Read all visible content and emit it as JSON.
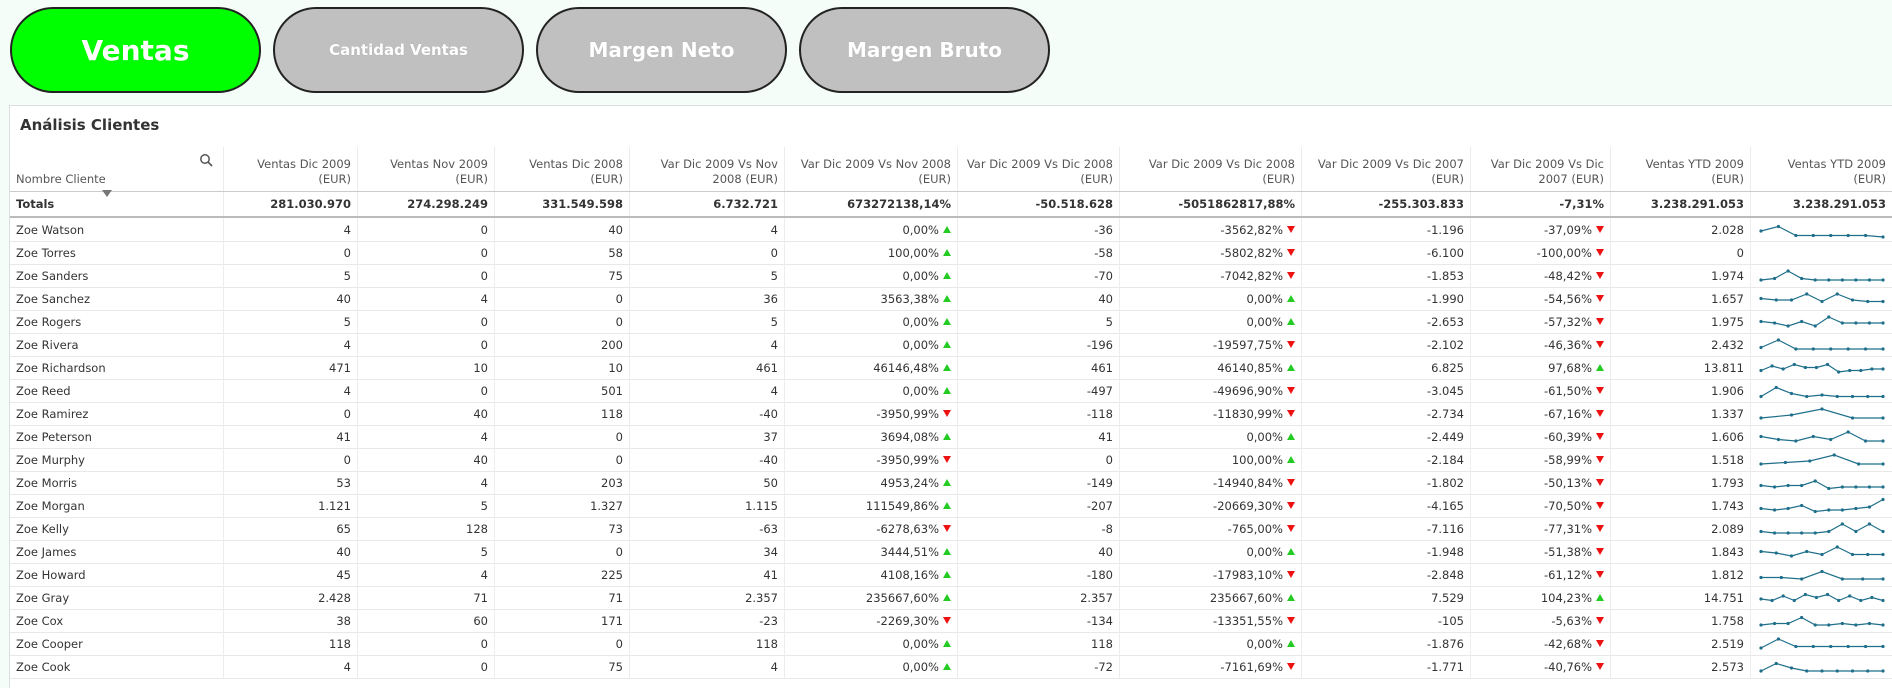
{
  "tabs": [
    {
      "label": "Ventas",
      "active": true
    },
    {
      "label": "Cantidad Ventas",
      "active": false
    },
    {
      "label": "Margen Neto",
      "active": false
    },
    {
      "label": "Margen Bruto",
      "active": false
    }
  ],
  "panel": {
    "title": "Análisis Clientes"
  },
  "table": {
    "headers": [
      "Nombre Cliente",
      "Ventas Dic 2009 (EUR)",
      "Ventas Nov 2009 (EUR)",
      "Ventas Dic 2008 (EUR)",
      "Var Dic 2009 Vs Nov 2008 (EUR)",
      "Var Dic 2009 Vs Nov 2008 (EUR)",
      "Var Dic 2009 Vs Dic 2008 (EUR)",
      "Var Dic 2009 Vs Dic 2008 (EUR)",
      "Var Dic 2009 Vs Dic 2007 (EUR)",
      "Var Dic 2009 Vs Dic 2007 (EUR)",
      "Ventas YTD 2009 (EUR)",
      "Ventas YTD 2009 (EUR)"
    ],
    "totals": [
      "Totals",
      "281.030.970",
      "274.298.249",
      "331.549.598",
      "6.732.721",
      "673272138,14%",
      "-50.518.628",
      "-5051862817,88%",
      "-255.303.833",
      "-7,31%",
      "3.238.291.053",
      "3.238.291.053"
    ],
    "rows": [
      {
        "name": "Zoe Watson",
        "c": [
          "4",
          "0",
          "40",
          "4",
          "0,00%",
          "-36",
          "-3562,82%",
          "-1.196",
          "-37,09%",
          "2.028"
        ],
        "a": [
          "up",
          "down",
          "down"
        ],
        "spark": [
          0.6,
          0.3,
          0.9,
          0.9,
          0.9,
          0.9,
          0.9,
          1.0
        ]
      },
      {
        "name": "Zoe Torres",
        "c": [
          "0",
          "0",
          "58",
          "0",
          "100,00%",
          "-58",
          "-5802,82%",
          "-6.100",
          "-100,00%",
          "0"
        ],
        "a": [
          "up",
          "down",
          "down"
        ],
        "spark": []
      },
      {
        "name": "Zoe Sanders",
        "c": [
          "5",
          "0",
          "75",
          "5",
          "0,00%",
          "-70",
          "-7042,82%",
          "-1.853",
          "-48,42%",
          "1.974"
        ],
        "a": [
          "up",
          "down",
          "down"
        ],
        "spark": [
          0.8,
          0.7,
          0.2,
          0.7,
          0.8,
          0.8,
          0.8,
          0.8,
          0.8,
          0.8
        ]
      },
      {
        "name": "Zoe Sanchez",
        "c": [
          "40",
          "4",
          "0",
          "36",
          "3563,38%",
          "40",
          "0,00%",
          "-1.990",
          "-54,56%",
          "1.657"
        ],
        "a": [
          "up",
          "up",
          "down"
        ],
        "spark": [
          0.5,
          0.6,
          0.6,
          0.2,
          0.7,
          0.2,
          0.6,
          0.7,
          0.7
        ]
      },
      {
        "name": "Zoe Rogers",
        "c": [
          "5",
          "0",
          "0",
          "5",
          "0,00%",
          "5",
          "0,00%",
          "-2.653",
          "-57,32%",
          "1.975"
        ],
        "a": [
          "up",
          "up",
          "down"
        ],
        "spark": [
          0.5,
          0.6,
          0.8,
          0.5,
          0.8,
          0.2,
          0.6,
          0.6,
          0.6,
          0.6
        ]
      },
      {
        "name": "Zoe Rivera",
        "c": [
          "4",
          "0",
          "200",
          "4",
          "0,00%",
          "-196",
          "-19597,75%",
          "-2.102",
          "-46,36%",
          "2.432"
        ],
        "a": [
          "up",
          "down",
          "down"
        ],
        "spark": [
          0.7,
          0.2,
          0.8,
          0.8,
          0.8,
          0.8,
          0.8,
          0.8
        ]
      },
      {
        "name": "Zoe Richardson",
        "c": [
          "471",
          "10",
          "10",
          "461",
          "46146,48%",
          "461",
          "46140,85%",
          "6.825",
          "97,68%",
          "13.811"
        ],
        "a": [
          "up",
          "up",
          "up"
        ],
        "spark": [
          0.7,
          0.4,
          0.6,
          0.3,
          0.5,
          0.5,
          0.3,
          0.8,
          0.7,
          0.7,
          0.6,
          0.6
        ]
      },
      {
        "name": "Zoe Reed",
        "c": [
          "4",
          "0",
          "501",
          "4",
          "0,00%",
          "-497",
          "-49696,90%",
          "-3.045",
          "-61,50%",
          "1.906"
        ],
        "a": [
          "up",
          "down",
          "down"
        ],
        "spark": [
          0.9,
          0.3,
          0.7,
          0.9,
          0.8,
          0.9,
          0.9,
          0.9,
          0.9
        ]
      },
      {
        "name": "Zoe Ramirez",
        "c": [
          "0",
          "40",
          "118",
          "-40",
          "-3950,99%",
          "-118",
          "-11830,99%",
          "-2.734",
          "-67,16%",
          "1.337"
        ],
        "a": [
          "down",
          "down",
          "down"
        ],
        "spark": [
          0.8,
          0.6,
          0.2,
          0.8,
          0.8
        ]
      },
      {
        "name": "Zoe Peterson",
        "c": [
          "41",
          "4",
          "0",
          "37",
          "3694,08%",
          "41",
          "0,00%",
          "-2.449",
          "-60,39%",
          "1.606"
        ],
        "a": [
          "up",
          "up",
          "down"
        ],
        "spark": [
          0.5,
          0.7,
          0.8,
          0.5,
          0.7,
          0.2,
          0.8,
          0.8
        ]
      },
      {
        "name": "Zoe Murphy",
        "c": [
          "0",
          "40",
          "0",
          "-40",
          "-3950,99%",
          "0",
          "100,00%",
          "-2.184",
          "-58,99%",
          "1.518"
        ],
        "a": [
          "down",
          "up",
          "down"
        ],
        "spark": [
          0.8,
          0.7,
          0.6,
          0.2,
          0.8,
          0.8
        ]
      },
      {
        "name": "Zoe Morris",
        "c": [
          "53",
          "4",
          "203",
          "50",
          "4953,24%",
          "-149",
          "-14940,84%",
          "-1.802",
          "-50,13%",
          "1.793"
        ],
        "a": [
          "up",
          "down",
          "down"
        ],
        "spark": [
          0.7,
          0.8,
          0.7,
          0.7,
          0.4,
          0.9,
          0.8,
          0.8,
          0.8,
          0.8
        ]
      },
      {
        "name": "Zoe Morgan",
        "c": [
          "1.121",
          "5",
          "1.327",
          "1.115",
          "111549,86%",
          "-207",
          "-20669,30%",
          "-4.165",
          "-70,50%",
          "1.743"
        ],
        "a": [
          "up",
          "down",
          "down"
        ],
        "spark": [
          0.7,
          0.8,
          0.7,
          0.5,
          0.9,
          0.8,
          0.8,
          0.7,
          0.6,
          0.1
        ]
      },
      {
        "name": "Zoe Kelly",
        "c": [
          "65",
          "128",
          "73",
          "-63",
          "-6278,63%",
          "-8",
          "-765,00%",
          "-7.116",
          "-77,31%",
          "2.089"
        ],
        "a": [
          "down",
          "down",
          "down"
        ],
        "spark": [
          0.7,
          0.8,
          0.8,
          0.8,
          0.8,
          0.7,
          0.2,
          0.7,
          0.2,
          0.7
        ]
      },
      {
        "name": "Zoe James",
        "c": [
          "40",
          "5",
          "0",
          "34",
          "3444,51%",
          "40",
          "0,00%",
          "-1.948",
          "-51,38%",
          "1.843"
        ],
        "a": [
          "up",
          "up",
          "down"
        ],
        "spark": [
          0.5,
          0.6,
          0.8,
          0.5,
          0.7,
          0.2,
          0.7,
          0.7,
          0.7
        ]
      },
      {
        "name": "Zoe Howard",
        "c": [
          "45",
          "4",
          "225",
          "41",
          "4108,16%",
          "-180",
          "-17983,10%",
          "-2.848",
          "-61,12%",
          "1.812"
        ],
        "a": [
          "up",
          "down",
          "down"
        ],
        "spark": [
          0.7,
          0.7,
          0.8,
          0.3,
          0.8,
          0.8,
          0.8
        ]
      },
      {
        "name": "Zoe Gray",
        "c": [
          "2.428",
          "71",
          "71",
          "2.357",
          "235667,60%",
          "2.357",
          "235667,60%",
          "7.529",
          "104,23%",
          "14.751"
        ],
        "a": [
          "up",
          "up",
          "up"
        ],
        "spark": [
          0.6,
          0.7,
          0.4,
          0.7,
          0.3,
          0.5,
          0.3,
          0.7,
          0.4,
          0.7,
          0.5,
          0.7
        ]
      },
      {
        "name": "Zoe Cox",
        "c": [
          "38",
          "60",
          "171",
          "-23",
          "-2269,30%",
          "-134",
          "-13351,55%",
          "-105",
          "-5,63%",
          "1.758"
        ],
        "a": [
          "down",
          "down",
          "down"
        ],
        "spark": [
          0.8,
          0.7,
          0.7,
          0.3,
          0.8,
          0.8,
          0.7,
          0.8,
          0.7,
          0.8
        ]
      },
      {
        "name": "Zoe Cooper",
        "c": [
          "118",
          "0",
          "0",
          "118",
          "0,00%",
          "118",
          "0,00%",
          "-1.876",
          "-42,68%",
          "2.519"
        ],
        "a": [
          "up",
          "up",
          "down"
        ],
        "spark": [
          0.8,
          0.2,
          0.7,
          0.7,
          0.7,
          0.7,
          0.7,
          0.7
        ]
      },
      {
        "name": "Zoe Cook",
        "c": [
          "4",
          "0",
          "75",
          "4",
          "0,00%",
          "-72",
          "-7161,69%",
          "-1.771",
          "-40,76%",
          "2.573"
        ],
        "a": [
          "up",
          "down",
          "down"
        ],
        "spark": [
          0.8,
          0.3,
          0.6,
          0.8,
          0.8,
          0.8,
          0.8,
          0.8,
          0.8
        ]
      }
    ]
  }
}
